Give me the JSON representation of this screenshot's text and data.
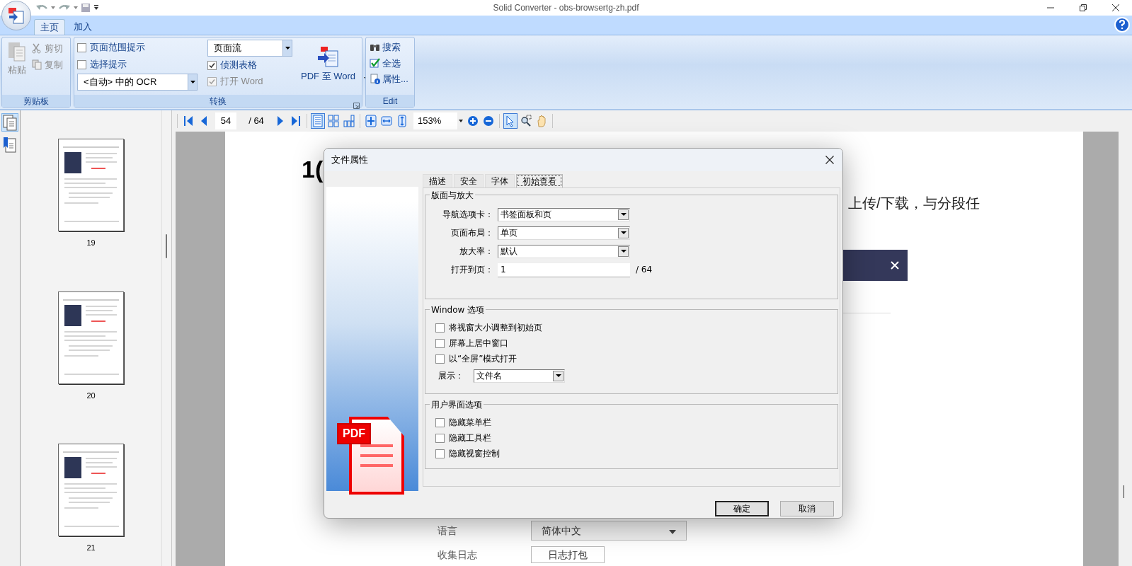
{
  "window": {
    "title": "Solid Converter - obs-browsertg-zh.pdf"
  },
  "ribbon": {
    "tabs": [
      {
        "label": "主页",
        "selected": true
      },
      {
        "label": "加入",
        "selected": false
      }
    ],
    "clipboard": {
      "label": "剪贴板",
      "paste": {
        "label": "粘贴",
        "disabled": true
      },
      "small": [
        {
          "label": "剪切",
          "disabled": true
        },
        {
          "label": "复制",
          "disabled": true
        }
      ]
    },
    "convert": {
      "label": "转换",
      "checkboxes": [
        {
          "label": "页面范围提示",
          "checked": false,
          "disabled": false
        },
        {
          "label": "选择提示",
          "checked": false,
          "disabled": false
        }
      ],
      "ocr_dropdown": {
        "value": "<自动> 中的 OCR"
      },
      "mode_dropdown": {
        "value": "页面流"
      },
      "options": [
        {
          "label": "侦测表格",
          "checked": true,
          "disabled": false
        },
        {
          "label": "打开 Word",
          "checked": true,
          "disabled": true
        }
      ],
      "convert_button": {
        "label": "PDF 至 Word"
      }
    },
    "edit": {
      "label": "Edit",
      "items": [
        {
          "label": "搜索"
        },
        {
          "label": "全选"
        },
        {
          "label": "属性..."
        }
      ]
    }
  },
  "toolbar": {
    "page": "54",
    "page_count": "/ 64",
    "zoom": "153%",
    "view_modes": [
      {
        "selected": true
      },
      {
        "selected": false
      },
      {
        "selected": false
      }
    ],
    "tools": [
      {
        "selected": true
      },
      {
        "selected": false
      },
      {
        "selected": false
      }
    ]
  },
  "sidebar": {
    "tabs": [
      {
        "selected": true
      },
      {
        "selected": false
      }
    ],
    "thumbnails": [
      {
        "label": "19"
      },
      {
        "label": "20"
      },
      {
        "label": "21"
      }
    ]
  },
  "document": {
    "heading": "1(",
    "text": "上传/下载，与分段任",
    "rows": [
      {
        "kind": "dropdown",
        "label": "语言",
        "value": "简体中文"
      },
      {
        "kind": "button",
        "label": "收集日志",
        "value": "日志打包"
      }
    ]
  },
  "dialog": {
    "title": "文件属性",
    "logo_text": "PDF",
    "tabs": [
      {
        "label": "描述",
        "selected": false
      },
      {
        "label": "安全",
        "selected": false
      },
      {
        "label": "字体",
        "selected": false
      },
      {
        "label": "初始查看",
        "selected": true
      }
    ],
    "groups": [
      {
        "title": "版面与放大",
        "fields": [
          {
            "kind": "dropdown",
            "label": "导航选项卡：",
            "value": "书签面板和页"
          },
          {
            "kind": "dropdown",
            "label": "页面布局：",
            "value": "单页"
          },
          {
            "kind": "dropdown",
            "label": "放大率：",
            "value": "默认"
          },
          {
            "kind": "input",
            "label": "打开到页：",
            "value": "1",
            "suffix": "/ 64"
          }
        ]
      },
      {
        "title": "Window 选项",
        "checkboxes": [
          {
            "label": "将视窗大小调整到初始页",
            "checked": false
          },
          {
            "label": "屏幕上居中窗口",
            "checked": false
          },
          {
            "label": "以“全屏”模式打开",
            "checked": false
          }
        ],
        "fields": [
          {
            "kind": "dropdown",
            "label": "展示：",
            "value": "文件名"
          }
        ]
      },
      {
        "title": "用户界面选项",
        "checkboxes": [
          {
            "label": "隐藏菜单栏",
            "checked": false
          },
          {
            "label": "隐藏工具栏",
            "checked": false
          },
          {
            "label": "隐藏视窗控制",
            "checked": false
          }
        ]
      }
    ],
    "buttons": [
      {
        "label": "确定",
        "default": true
      },
      {
        "label": "取消",
        "default": false
      }
    ]
  }
}
